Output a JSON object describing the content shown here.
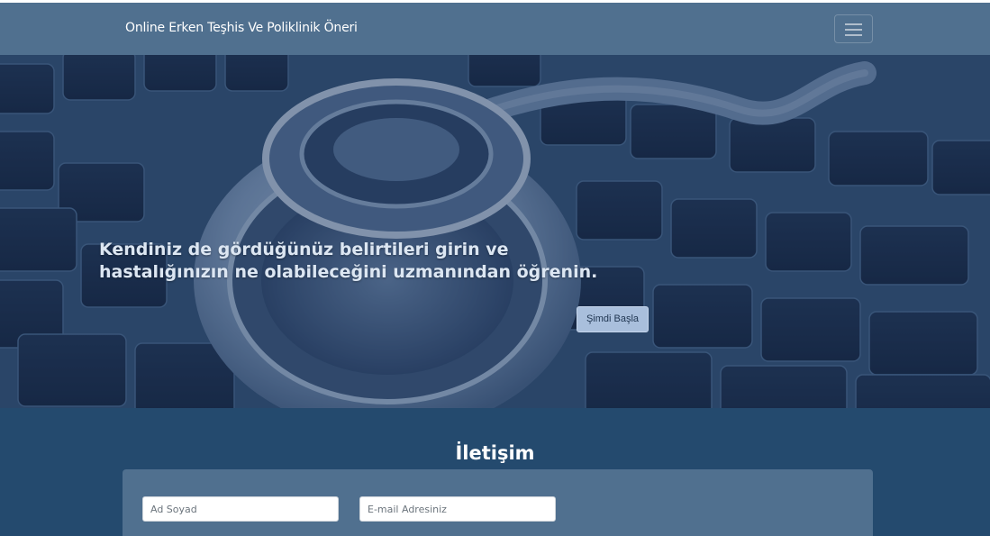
{
  "navbar": {
    "brand": "Online Erken Teşhis Ve Poliklinik Öneri",
    "toggler_icon": "hamburger-menu-icon"
  },
  "hero": {
    "headline": "Kendiniz de gördüğünüz belirtileri girin ve hastalığınızın ne olabileceğini uzmanından öğrenin.",
    "cta_label": "Şimdi Başla",
    "background_image": "stethoscope-on-keyboard"
  },
  "contact": {
    "title": "İletişim",
    "name_placeholder": "Ad Soyad",
    "email_placeholder": "E-mail Adresiniz"
  },
  "colors": {
    "navbar": "#50708f",
    "section": "#244a6e",
    "card": "#50708f",
    "button": "#a9bfdc"
  }
}
